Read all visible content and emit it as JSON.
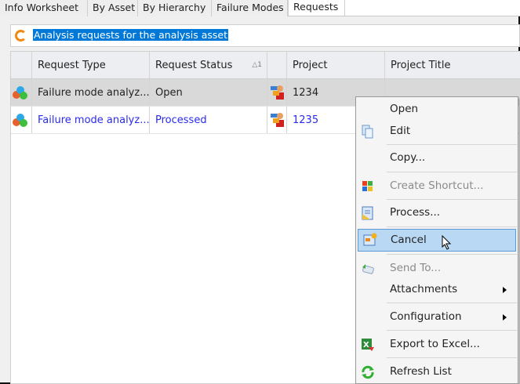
{
  "tabs": [
    {
      "label": "Info Worksheet"
    },
    {
      "label": "By Asset"
    },
    {
      "label": "By Hierarchy"
    },
    {
      "label": "Failure Modes"
    },
    {
      "label": "Requests",
      "active": true
    }
  ],
  "title": "Analysis requests for the analysis asset",
  "grid": {
    "columns": [
      "Request Type",
      "Request Status",
      "Project",
      "Project Title"
    ],
    "sort_indicator": "1",
    "rows": [
      {
        "type": "Failure mode analyz...",
        "status": "Open",
        "project": "1234",
        "title": ""
      },
      {
        "type": "Failure mode analyz...",
        "status": "Processed",
        "project": "1235",
        "title": ""
      }
    ]
  },
  "menu": {
    "items": [
      {
        "label": "Open"
      },
      {
        "label": "Edit"
      },
      {
        "label": "Copy..."
      },
      {
        "label": "Create Shortcut...",
        "disabled": true
      },
      {
        "label": "Process..."
      },
      {
        "label": "Cancel",
        "highlighted": true
      },
      {
        "label": "Send To...",
        "disabled": true
      },
      {
        "label": "Attachments"
      },
      {
        "label": "Configuration"
      },
      {
        "label": "Export to Excel..."
      },
      {
        "label": "Refresh List"
      }
    ]
  },
  "colors": {
    "selection": "#0078d7",
    "link_row": "#2a2af0",
    "menu_highlight": "#b9d8f3"
  }
}
